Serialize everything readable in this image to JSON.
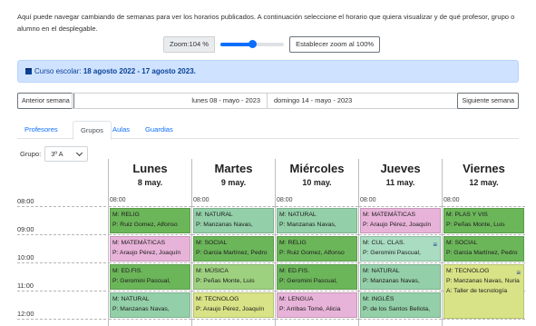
{
  "intro_text": "Aquí puede navegar cambiando de semanas para ver los horarios publicados. A continuación seleccione el horario que quiera visualizar y de qué profesor, grupo o alumno en el desplegable.",
  "zoom": {
    "label": "Zoom:104 %",
    "level": 0.5,
    "reset_label": "Establecer zoom al 100%"
  },
  "school_year": {
    "prefix": "Curso escolar:",
    "range": "18 agosto 2022 - 17 agosto 2023."
  },
  "week_nav": {
    "prev_label": "Anterior semana",
    "from": "lunes 08 - mayo - 2023",
    "to": "domingo 14 - mayo - 2023",
    "next_label": "Siguiente semana"
  },
  "tabs": [
    {
      "label": "Profesores",
      "active": false
    },
    {
      "label": "Grupos",
      "active": true
    },
    {
      "label": "Aulas",
      "active": false
    },
    {
      "label": "Guardias",
      "active": false
    }
  ],
  "group": {
    "label": "Grupo:",
    "value": "3º A"
  },
  "times": [
    "08:00",
    "09:00",
    "10:00",
    "11:00",
    "12:00"
  ],
  "days": [
    {
      "name": "Lunes",
      "date": "8 may.",
      "start": "08:00",
      "lessons": [
        {
          "subject": "M: RELIG",
          "teacher": "P: Ruiz Gomez, Alfonso",
          "color": "#6cb65a",
          "slot": 0
        },
        {
          "subject": "M: MATEMÁTICAS",
          "teacher": "P: Araujo Pérez, Joaquín",
          "color": "#e8b3d9",
          "slot": 1
        },
        {
          "subject": "M: ED.FIS.",
          "teacher": "P: Geromini Pascual,",
          "color": "#6cb65a",
          "slot": 2
        },
        {
          "subject": "M: NATURAL",
          "teacher": "P: Manzanas Navas,",
          "color": "#93cfa8",
          "slot": 3
        }
      ]
    },
    {
      "name": "Martes",
      "date": "9 may.",
      "start": "08:00",
      "lessons": [
        {
          "subject": "M: NATURAL",
          "teacher": "P: Manzanas Navas,",
          "color": "#93cfa8",
          "slot": 0
        },
        {
          "subject": "M: SOCIAL",
          "teacher": "P: Garcia Martínez, Pedro",
          "color": "#6cb65a",
          "slot": 1
        },
        {
          "subject": "M: MÚSICA",
          "teacher": "P: Peñas Monte, Luis",
          "color": "#9ed17f",
          "slot": 2
        },
        {
          "subject": "M: TECNOLOG",
          "teacher": "P: Araujo Pérez, Joaquín",
          "color": "#d7e386",
          "slot": 3
        }
      ]
    },
    {
      "name": "Miércoles",
      "date": "10 may.",
      "start": "08:00",
      "lessons": [
        {
          "subject": "M: NATURAL",
          "teacher": "P: Manzanas Navas,",
          "color": "#93cfa8",
          "slot": 0
        },
        {
          "subject": "M: RELIG",
          "teacher": "P: Ruiz Gomez, Alfonso",
          "color": "#6cb65a",
          "slot": 1
        },
        {
          "subject": "M: ED.FIS.",
          "teacher": "P: Geromini Pascual,",
          "color": "#6cb65a",
          "slot": 2
        },
        {
          "subject": "M: LENGUA",
          "teacher": "P: Arribas Tomé, Alicia",
          "color": "#e8b3d9",
          "slot": 3
        }
      ]
    },
    {
      "name": "Jueves",
      "date": "11 may.",
      "start": "08:00",
      "lessons": [
        {
          "subject": "M: MATEMÁTICAS",
          "teacher": "P: Araujo Pérez, Joaquín",
          "color": "#e8b3d9",
          "slot": 0
        },
        {
          "subject": "M: CUL. CLAS.",
          "teacher": "P: Geromini Pascual,",
          "color": "#a9dcc0",
          "slot": 1,
          "pair": true
        },
        {
          "subject": "M: NATURAL",
          "teacher": "P: Manzanas Navas,",
          "color": "#93cfa8",
          "slot": 2
        },
        {
          "subject": "M: INGLÉS",
          "teacher": "P: de los Santos Bellota,",
          "color": "#93cfa8",
          "slot": 3
        }
      ]
    },
    {
      "name": "Viernes",
      "date": "12 may.",
      "start": "08:00",
      "lessons": [
        {
          "subject": "M: PLAS Y VIS",
          "teacher": "P: Peñas Monte, Luis",
          "color": "#6cb65a",
          "slot": 0
        },
        {
          "subject": "M: SOCIAL",
          "teacher": "P: Garcia Martínez, Pedro",
          "color": "#6cb65a",
          "slot": 1
        },
        {
          "subject": "M: TECNOLOG",
          "teacher": "P: Manzanas Navas, Nuria",
          "room": "A: Taller de tecnología",
          "color": "#d7e386",
          "slot": 2,
          "tall": true,
          "pair": true
        }
      ]
    }
  ]
}
